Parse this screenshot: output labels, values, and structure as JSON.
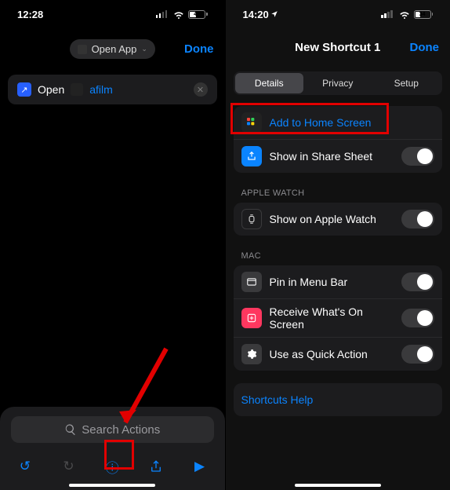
{
  "left": {
    "status": {
      "time": "12:28",
      "battery": "41"
    },
    "header": {
      "pill_label": "Open App",
      "done": "Done"
    },
    "action": {
      "verb": "Open",
      "param": "afilm"
    },
    "search_placeholder": "Search Actions"
  },
  "right": {
    "status": {
      "time": "14:20",
      "battery": "34"
    },
    "header": {
      "title": "New Shortcut 1",
      "done": "Done"
    },
    "segments": {
      "details": "Details",
      "privacy": "Privacy",
      "setup": "Setup"
    },
    "group1": {
      "add_home": "Add to Home Screen",
      "share_sheet": "Show in Share Sheet"
    },
    "watch_header": "Apple Watch",
    "watch_row": "Show on Apple Watch",
    "mac_header": "Mac",
    "mac": {
      "pin": "Pin in Menu Bar",
      "receive": "Receive What's On Screen",
      "quick": "Use as Quick Action"
    },
    "help": "Shortcuts Help"
  }
}
